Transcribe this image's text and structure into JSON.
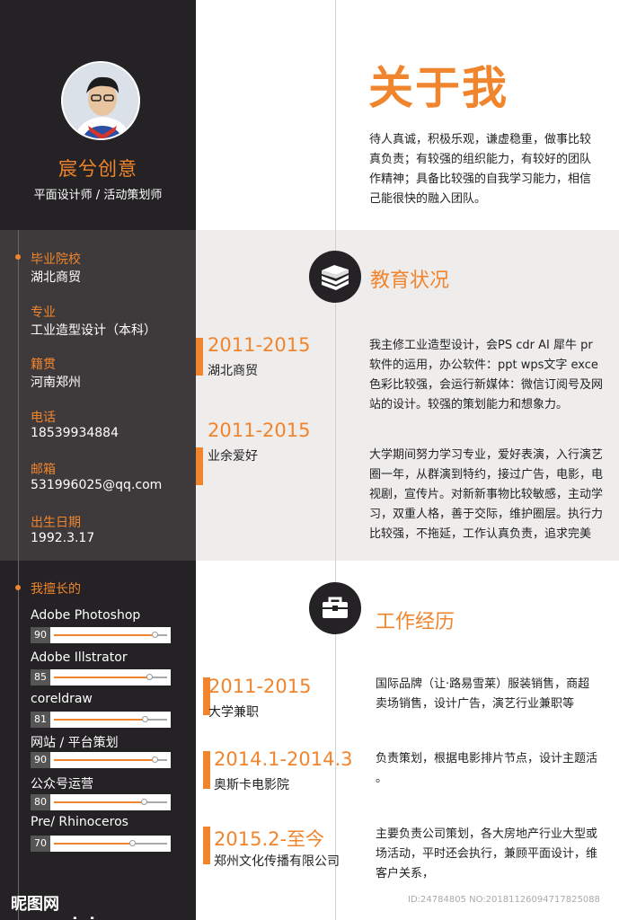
{
  "profile": {
    "name": "宸兮创意",
    "role": "平面设计师 / 活动策划师"
  },
  "info": [
    {
      "label": "毕业院校",
      "value": "湖北商贸"
    },
    {
      "label": "专业",
      "value": "工业造型设计（本科）"
    },
    {
      "label": "籍贯",
      "value": "河南郑州"
    },
    {
      "label": "电话",
      "value": "18539934884"
    },
    {
      "label": "邮箱",
      "value": "531996025@qq.com"
    },
    {
      "label": "出生日期",
      "value": "1992.3.17"
    }
  ],
  "skills": {
    "title": "我擅长的",
    "items": [
      {
        "name": "Adobe Photoshop",
        "level": "90",
        "fraction": 0.9
      },
      {
        "name": "Adobe Illstrator",
        "level": "85",
        "fraction": 0.85
      },
      {
        "name": "coreldraw",
        "level": "81",
        "fraction": 0.81
      },
      {
        "name": "网站 / 平台策划",
        "level": "90",
        "fraction": 0.9
      },
      {
        "name": "公众号运营",
        "level": "80",
        "fraction": 0.8
      },
      {
        "name": "Pre/ Rhinoceros",
        "level": "70",
        "fraction": 0.7
      }
    ]
  },
  "about": {
    "title": "关于我",
    "lines": [
      "待人真诚，积极乐观，谦虚稳重，做事比较",
      "真负责；有较强的组织能力，有较好的团队",
      "作精神；具备比较强的自我学习能力，相信",
      "己能很快的融入团队。"
    ]
  },
  "education": {
    "title": "教育状况",
    "entries": [
      {
        "year": "2011-2015",
        "sub": "湖北商贸",
        "lines": [
          "我主修工业造型设计，会PS cdr AI 犀牛 pr",
          "软件的运用，办公软件：ppt wps文字  exce",
          "色彩比较强，会运行新媒体：微信订阅号及网",
          "站的设计。较强的策划能力和想象力。"
        ]
      },
      {
        "year": "2011-2015",
        "sub": "业余爱好",
        "lines": [
          "大学期间努力学习专业，爱好表演，入行演艺",
          "圈一年，从群演到特约，接过广告，电影，电",
          "视剧，宣传片。对新新事物比较敏感，主动学",
          "习，双重人格，善于交际，维护圈层。执行力",
          "比较强，不拖延，工作认真负责，追求完美"
        ]
      }
    ]
  },
  "work": {
    "title": "工作经历",
    "entries": [
      {
        "year": "2011-2015",
        "sub": "大学兼职",
        "lines": [
          "国际品牌（让·路易雪莱）服装销售，商超",
          "卖场销售，设计广告，演艺行业兼职等"
        ]
      },
      {
        "year": "2014.1-2014.3",
        "sub": "奥斯卡电影院",
        "lines": [
          "负责策划，根据电影排片节点，设计主题活",
          "。"
        ]
      },
      {
        "year": "2015.2-至今",
        "sub": "郑州文化传播有限公司",
        "lines": [
          "主要负责公司策划，各大房地产行业大型或",
          "场活动，平时还会执行，兼顾平面设计，维",
          "客户关系，"
        ]
      }
    ]
  },
  "watermark": {
    "left": "昵图网 www.nipic.com",
    "right": "ID:24784805 NO:20181126094717825088"
  },
  "colors": {
    "accent": "#f0852d",
    "sidebar": "#242224",
    "sidebar_mid": "#3e3a3c"
  },
  "icons": {
    "education": "books-icon",
    "work": "briefcase-icon"
  }
}
